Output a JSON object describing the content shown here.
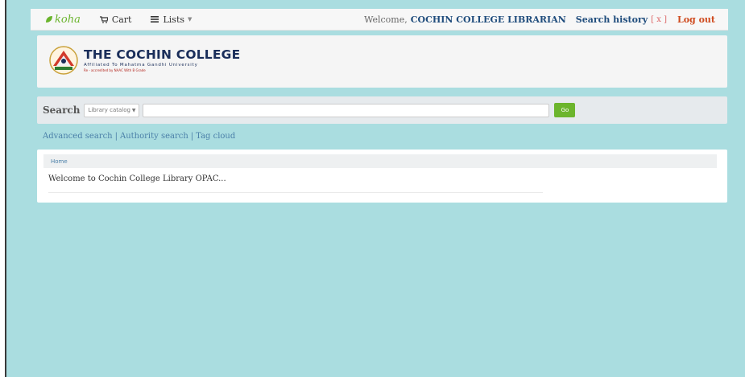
{
  "navbar": {
    "brand": "koha",
    "cart_label": "Cart",
    "lists_label": "Lists",
    "welcome_text": "Welcome,",
    "username": "COCHIN COLLEGE LIBRARIAN",
    "search_history_label": "Search history",
    "clear_history": "[ x ]",
    "logout_label": "Log out"
  },
  "header": {
    "college_name": "THE COCHIN COLLEGE",
    "affiliation": "Affiliated To Mahatma Gandhi University",
    "accreditation": "Re - accredited by NAAC With B Grade"
  },
  "search": {
    "label": "Search",
    "scope_selected": "Library catalog",
    "input_value": "",
    "go_label": "Go"
  },
  "more_searches": {
    "advanced": "Advanced search",
    "authority": "Authority search",
    "tag_cloud": "Tag cloud",
    "separator": "|"
  },
  "main": {
    "breadcrumb_home": "Home",
    "welcome_message": "Welcome to Cochin College Library OPAC..."
  },
  "colors": {
    "page_bg": "#aadde0",
    "koha_green": "#6ab42c",
    "link_blue": "#4a7fa8",
    "logout_orange": "#cf4b1f",
    "go_button": "#6cb52d"
  }
}
